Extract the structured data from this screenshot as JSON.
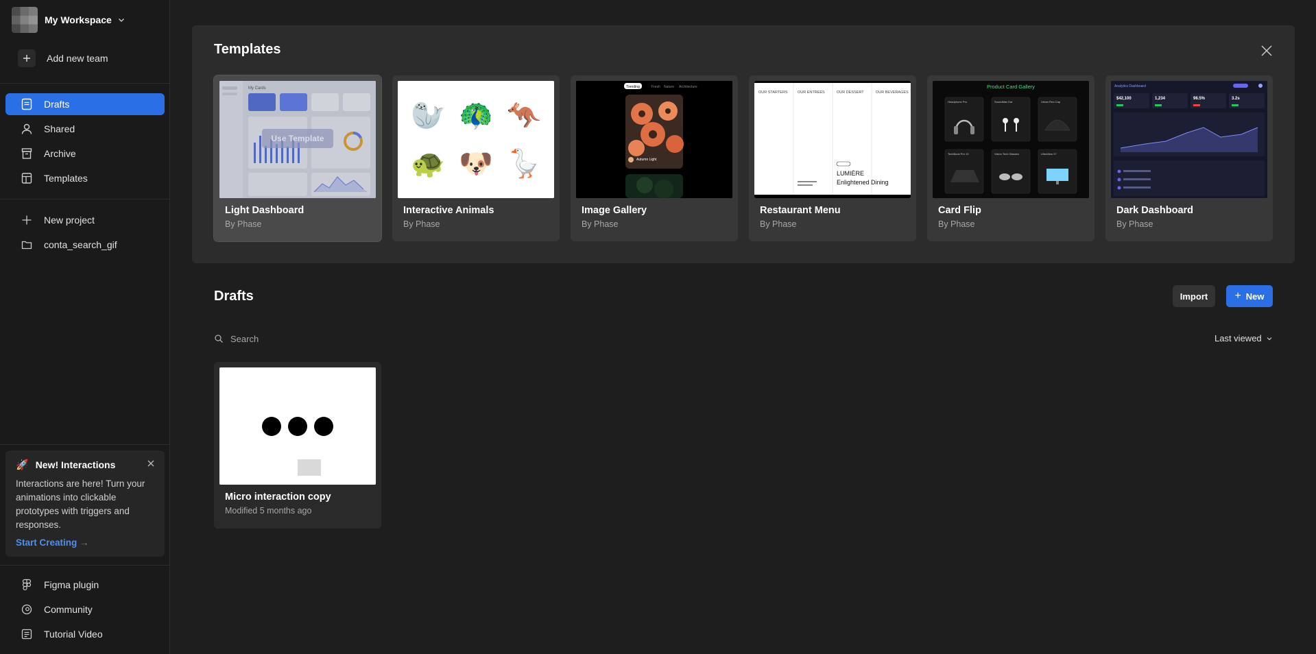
{
  "workspace": {
    "name": "My Workspace"
  },
  "sidebar": {
    "add_team": "Add new team",
    "nav": [
      {
        "label": "Drafts",
        "icon": "drafts-icon",
        "active": true
      },
      {
        "label": "Shared",
        "icon": "user-icon"
      },
      {
        "label": "Archive",
        "icon": "archive-icon"
      },
      {
        "label": "Templates",
        "icon": "templates-icon"
      }
    ],
    "new_project": "New project",
    "projects": [
      {
        "label": "conta_search_gif",
        "icon": "folder-icon"
      }
    ],
    "footer": [
      {
        "label": "Figma plugin",
        "icon": "figma-icon"
      },
      {
        "label": "Community",
        "icon": "community-icon"
      },
      {
        "label": "Tutorial Video",
        "icon": "video-icon"
      }
    ]
  },
  "promo": {
    "emoji": "🚀",
    "title": "New! Interactions",
    "body": "Interactions are here! Turn your animations into clickable prototypes with triggers and responses.",
    "link": "Start Creating →"
  },
  "templates": {
    "title": "Templates",
    "hover_label": "Use Template",
    "items": [
      {
        "name": "Light Dashboard",
        "by": "By Phase"
      },
      {
        "name": "Interactive Animals",
        "by": "By Phase"
      },
      {
        "name": "Image Gallery",
        "by": "By Phase"
      },
      {
        "name": "Restaurant Menu",
        "by": "By Phase"
      },
      {
        "name": "Card Flip",
        "by": "By Phase"
      },
      {
        "name": "Dark Dashboard",
        "by": "By Phase"
      }
    ],
    "thumb_text": {
      "light_dash_title": "My Cards",
      "gallery_tabs": [
        "Trending",
        "Fresh",
        "Nature",
        "Architecture"
      ],
      "gallery_caption": "Autumn Light",
      "menu_columns": [
        "OUR STARTERS",
        "OUR ENTREES",
        "OUR DESSERT",
        "OUR BEVERAGES"
      ],
      "menu_brand": "LUMIÈRE",
      "menu_tagline": "Enlightened Dining",
      "card_flip_title": "Product Card Gallery",
      "card_flip_products": [
        "Headphone Pro",
        "SoundMax Ear",
        "Urban Flex Cap",
        "TechBook Pro 13",
        "Vision Tech Glasses",
        "UltraView 27"
      ],
      "dark_dash_title": "Analytics Dashboard",
      "dark_dash_stats": [
        "$42,100",
        "1,234",
        "98.5%",
        "3.2s"
      ]
    }
  },
  "drafts": {
    "title": "Drafts",
    "import_label": "Import",
    "new_label": "New",
    "search_placeholder": "Search",
    "sort_label": "Last viewed",
    "items": [
      {
        "name": "Micro interaction copy",
        "modified": "Modified 5 months ago"
      }
    ]
  },
  "colors": {
    "accent": "#2b6fe6",
    "link": "#4d8ff5",
    "bg": "#1e1e1e",
    "panel": "#2c2c2c"
  }
}
